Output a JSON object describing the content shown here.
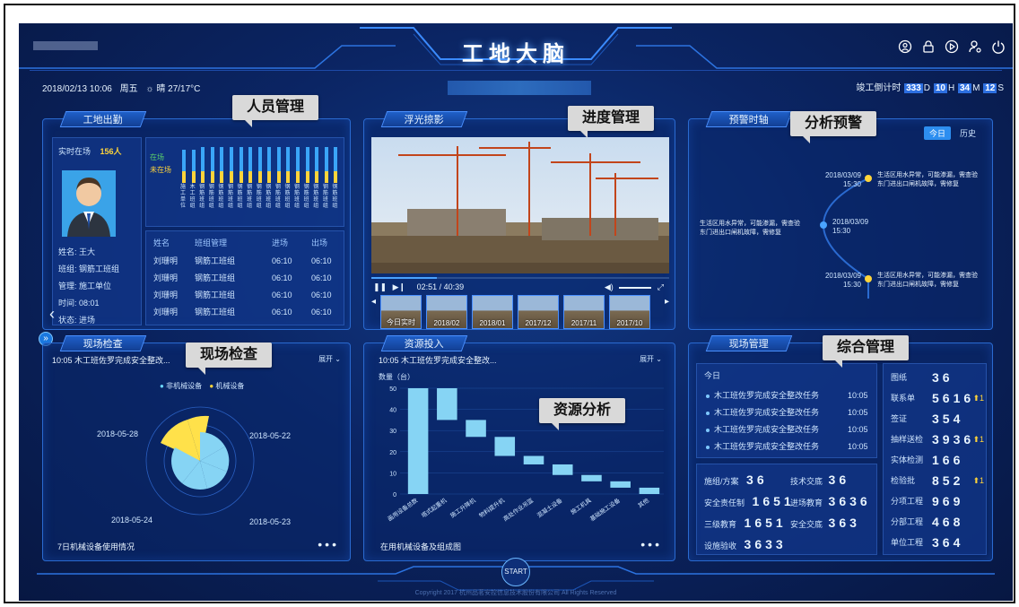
{
  "header": {
    "title": "工地大脑",
    "datetime": "2018/02/13 10:06",
    "weekday": "周五",
    "weather": "晴 27/17°C",
    "countdown_label": "竣工倒计时",
    "countdown": {
      "d": "333",
      "d_unit": "D",
      "h": "10",
      "h_unit": "H",
      "m": "34",
      "m_unit": "M",
      "s": "12",
      "s_unit": "S"
    }
  },
  "callouts": {
    "personnel": "人员管理",
    "progress": "进度管理",
    "warning": "分析预警",
    "inspection": "现场检查",
    "resource": "资源分析",
    "general": "综合管理"
  },
  "attendance": {
    "title": "工地出勤",
    "present_label": "实时在场",
    "present_count": "156人",
    "legend_in": "在场",
    "legend_out": "未在场",
    "bar_labels": [
      "施工单位",
      "木工班组",
      "钢筋班组",
      "钢筋班组",
      "钢筋班组",
      "钢筋班组",
      "钢筋班组",
      "钢筋班组",
      "钢筋班组",
      "钢筋班组",
      "钢筋班组",
      "钢筋班组",
      "钢筋班组",
      "钢筋班组",
      "钢筋班组",
      "钢筋班组",
      "钢筋班组"
    ],
    "bars": [
      [
        0.55,
        0.3
      ],
      [
        0.55,
        0.3
      ],
      [
        0.6,
        0.3
      ],
      [
        0.6,
        0.3
      ],
      [
        0.6,
        0.3
      ],
      [
        0.6,
        0.3
      ],
      [
        0.6,
        0.3
      ],
      [
        0.6,
        0.3
      ],
      [
        0.6,
        0.3
      ],
      [
        0.6,
        0.3
      ],
      [
        0.6,
        0.3
      ],
      [
        0.6,
        0.3
      ],
      [
        0.6,
        0.3
      ],
      [
        0.6,
        0.3
      ],
      [
        0.6,
        0.3
      ],
      [
        0.6,
        0.3
      ],
      [
        0.6,
        0.3
      ]
    ],
    "profile": [
      {
        "k": "姓名:",
        "v": "王大"
      },
      {
        "k": "班组:",
        "v": "钢筋工班组"
      },
      {
        "k": "管理:",
        "v": "施工单位"
      },
      {
        "k": "时间:",
        "v": "08:01"
      },
      {
        "k": "状态:",
        "v": "进场"
      }
    ],
    "table_headers": [
      "姓名",
      "班组管理",
      "进场",
      "出场"
    ],
    "table_rows": [
      [
        "刘珊明",
        "钢筋工班组",
        "06:10",
        "06:10"
      ],
      [
        "刘珊明",
        "钢筋工班组",
        "06:10",
        "06:10"
      ],
      [
        "刘珊明",
        "钢筋工班组",
        "06:10",
        "06:10"
      ],
      [
        "刘珊明",
        "钢筋工班组",
        "06:10",
        "06:10"
      ]
    ]
  },
  "video": {
    "title": "浮光掠影",
    "time": "02:51 / 40:39",
    "progress": 0.22,
    "thumbs": [
      "今日实时",
      "2018/02",
      "2018/01",
      "2017/12",
      "2017/11",
      "2017/10"
    ]
  },
  "timeline": {
    "title": "预警时轴",
    "tab_today": "今日",
    "tab_history": "历史",
    "events": [
      {
        "date": "2018/03/09",
        "time": "15:30",
        "text1": "生活区用水异常，可能渗漏，需查验",
        "text2": "东门进出口闸机故障，需修复"
      },
      {
        "date": "2018/03/09",
        "time": "15:30",
        "text1": "生活区用水异常，可能渗漏，需查验",
        "text2": "东门进出口闸机故障，需修复"
      },
      {
        "date": "2018/03/09",
        "time": "15:30",
        "text1": "生活区用水异常，可能渗漏，需查验",
        "text2": "东门进出口闸机故障，需修复"
      }
    ]
  },
  "inspection": {
    "title": "现场检查",
    "latest": "10:05 木工班佐罗完成安全整改...",
    "expand": "展开",
    "legend_1": "非机械设备",
    "legend_2": "机械设备",
    "dates": [
      "2018-05-28",
      "2018-05-22",
      "2018-05-24",
      "2018-05-23"
    ],
    "footer": "7日机械设备使用情况"
  },
  "resource": {
    "title": "资源投入",
    "latest": "10:05 木工班佐罗完成安全整改...",
    "expand": "展开",
    "footer": "在用机械设备及组成图"
  },
  "chart_data": {
    "type": "bar",
    "ylabel": "数量（台）",
    "ylim": [
      0,
      50
    ],
    "yticks": [
      0,
      10,
      20,
      30,
      40,
      50
    ],
    "categories": [
      "画用设备总数",
      "塔式起重机",
      "施工升降机",
      "物料提升机",
      "高处作业吊篮",
      "混凝土设备",
      "施工机具",
      "基础施工设备",
      "其他"
    ],
    "bars": [
      [
        0,
        50
      ],
      [
        35,
        50
      ],
      [
        27,
        35
      ],
      [
        18,
        27
      ],
      [
        14,
        18
      ],
      [
        9,
        14
      ],
      [
        6,
        9
      ],
      [
        3,
        6
      ],
      [
        0,
        3
      ]
    ]
  },
  "general": {
    "title": "现场管理",
    "today": "今日",
    "tasks": [
      {
        "text": "木工班佐罗完成安全整改任务",
        "time": "10:05"
      },
      {
        "text": "木工班佐罗完成安全整改任务",
        "time": "10:05"
      },
      {
        "text": "木工班佐罗完成安全整改任务",
        "time": "10:05"
      },
      {
        "text": "木工班佐罗完成安全整改任务",
        "time": "10:05"
      }
    ],
    "bottom_left": [
      {
        "k": "施组/方案",
        "v": "36",
        "k2": "技术交底",
        "v2": "36"
      },
      {
        "k": "安全责任制",
        "v": "1651",
        "k2": "进场教育",
        "v2": "3636"
      },
      {
        "k": "三级教育",
        "v": "1651",
        "k2": "安全交底",
        "v2": "363"
      },
      {
        "k": "设施验收",
        "v": "3633",
        "k2": "",
        "v2": ""
      }
    ],
    "right": [
      {
        "k": "图纸",
        "v": "36",
        "up": false
      },
      {
        "k": "联系单",
        "v": "5616",
        "up": true
      },
      {
        "k": "签证",
        "v": "354",
        "up": false
      },
      {
        "k": "抽样送检",
        "v": "3936",
        "up": true
      },
      {
        "k": "实体检测",
        "v": "166",
        "up": false
      },
      {
        "k": "检验批",
        "v": "852",
        "up": true
      },
      {
        "k": "分项工程",
        "v": "969",
        "up": false
      },
      {
        "k": "分部工程",
        "v": "468",
        "up": false
      },
      {
        "k": "单位工程",
        "v": "364",
        "up": false
      }
    ]
  },
  "footer": {
    "start": "START",
    "copyright": "Copyright 2017 杭州品茗安控信息技术股份有限公司 All Rights Reserved"
  },
  "colors": {
    "accent": "#2d6fe0",
    "yellow": "#ffd43a",
    "cyan": "#6cd8ff",
    "bg": "#0b2564"
  }
}
